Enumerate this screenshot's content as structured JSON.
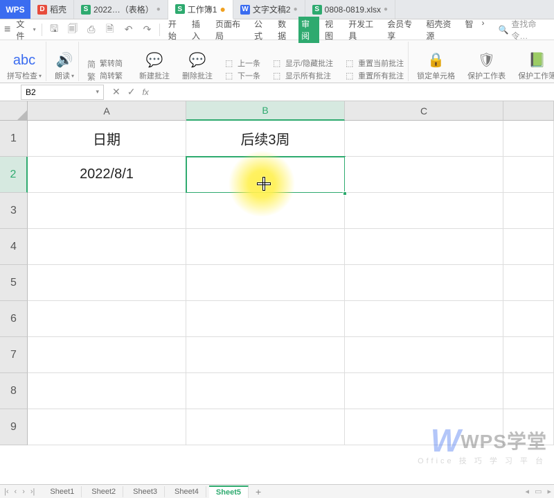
{
  "app": {
    "logo": "WPS"
  },
  "tabs": [
    {
      "icon": "red",
      "iconLetter": "D",
      "label": "稻壳",
      "dot": false
    },
    {
      "icon": "green",
      "iconLetter": "S",
      "label": "2022…（表格）",
      "dot": true
    },
    {
      "icon": "green",
      "iconLetter": "S",
      "label": "工作簿1",
      "dot": true,
      "active": true,
      "dotColor": "orange"
    },
    {
      "icon": "blue",
      "iconLetter": "W",
      "label": "文字文稿2",
      "dot": true
    },
    {
      "icon": "green",
      "iconLetter": "S",
      "label": "0808-0819.xlsx",
      "dot": true
    }
  ],
  "file": {
    "label": "文件"
  },
  "ribbonTabs": [
    "开始",
    "插入",
    "页面布局",
    "公式",
    "数据",
    "审阅",
    "视图",
    "开发工具",
    "会员专享",
    "稻壳资源",
    "智"
  ],
  "ribbonActive": "审阅",
  "search": {
    "label": "查找命令…"
  },
  "ribbon": {
    "spellcheck": "拼写检查",
    "read": "朗读",
    "simp2trad": "繁转简",
    "trad2simp": "简转繁",
    "newComment": "新建批注",
    "delComment": "删除批注",
    "prevComment": "上一条",
    "nextComment": "下一条",
    "showHideComment": "显示/隐藏批注",
    "showAllComment": "显示所有批注",
    "resetCurrent": "重置当前批注",
    "resetAll": "重置所有批注",
    "lockCell": "锁定单元格",
    "protectSheet": "保护工作表",
    "protectBook": "保护工作簿"
  },
  "nameBox": {
    "value": "B2"
  },
  "fx": {
    "label": "fx"
  },
  "formula": {
    "value": ""
  },
  "columns": [
    "A",
    "B",
    "C"
  ],
  "rows": [
    "1",
    "2",
    "3",
    "4",
    "5",
    "6",
    "7",
    "8",
    "9"
  ],
  "cells": {
    "A1": "日期",
    "B1": "后续3周",
    "A2": "2022/8/1"
  },
  "selectedCell": "B2",
  "sheets": [
    "Sheet1",
    "Sheet2",
    "Sheet3",
    "Sheet4",
    "Sheet5"
  ],
  "activeSheet": "Sheet5",
  "watermark": {
    "logo": "W",
    "text": "WPS学堂",
    "sub": "Office 技 巧 学 习 平 台"
  }
}
